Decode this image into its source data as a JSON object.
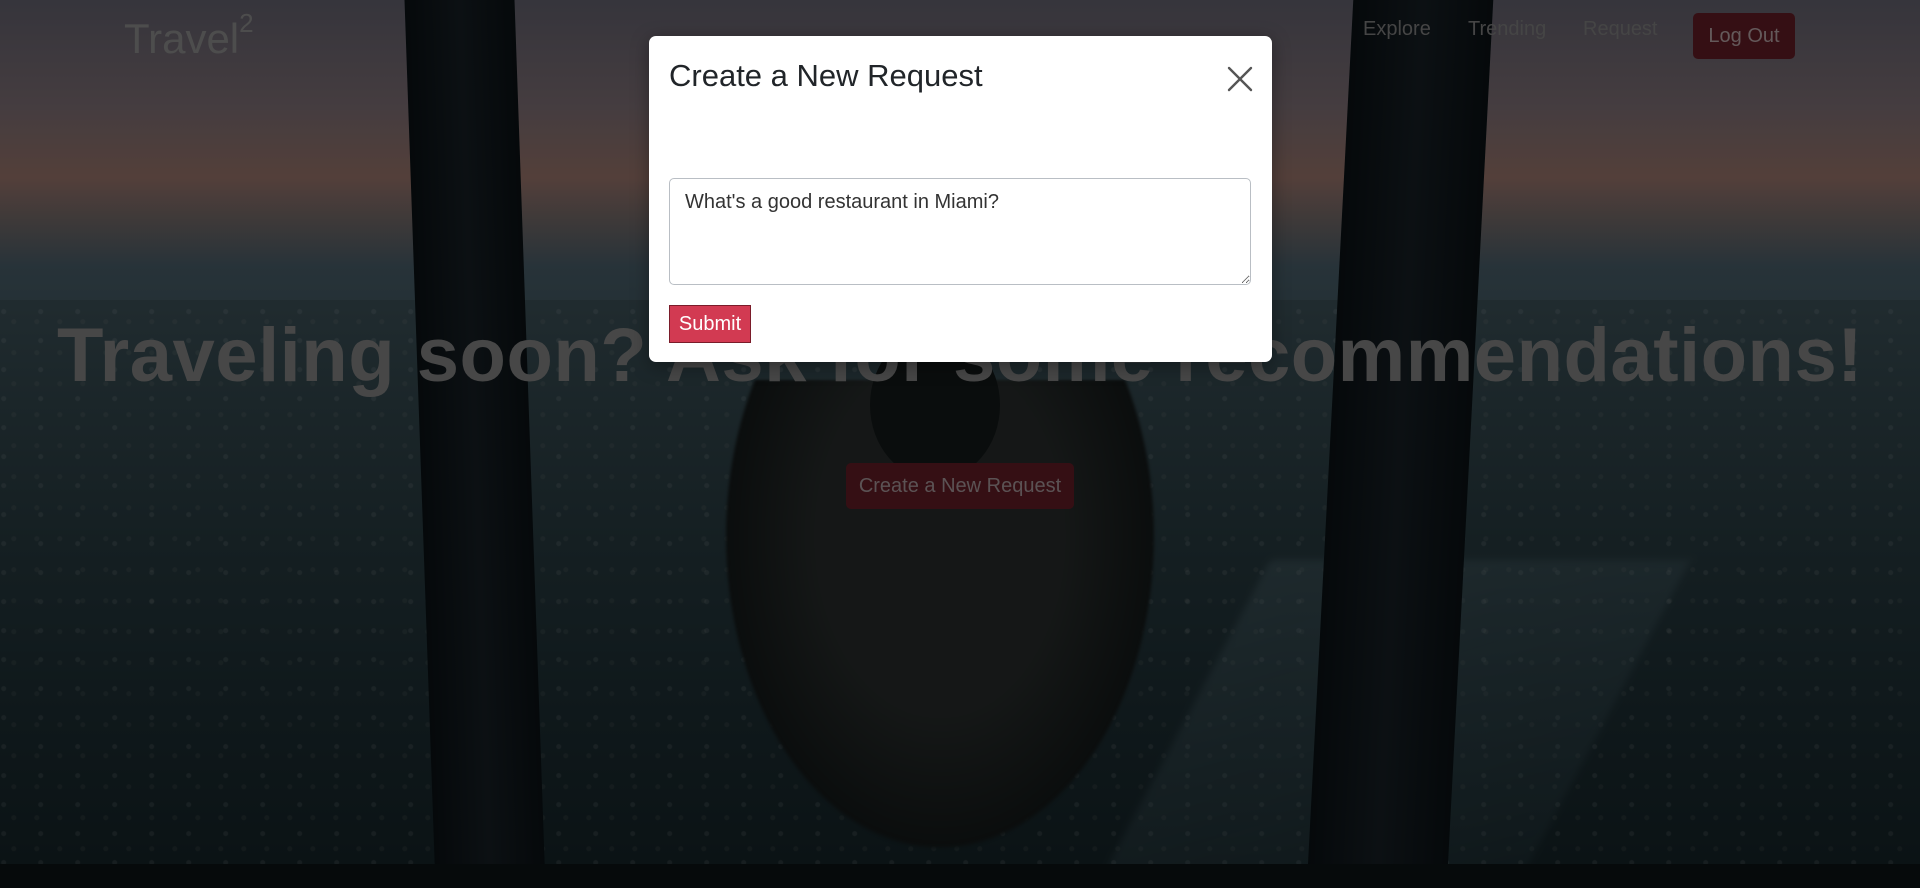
{
  "brand": {
    "name": "Travel",
    "superscript": "2"
  },
  "nav": {
    "links": [
      "Explore",
      "Trending",
      "Request"
    ],
    "logout_label": "Log Out"
  },
  "hero": {
    "title": "Traveling soon? Ask for some recommendations!",
    "cta_label": "Create a New Request"
  },
  "modal": {
    "title": "Create a New Request",
    "textarea_value": "What's a good restaurant in Miami?",
    "submit_label": "Submit"
  },
  "colors": {
    "accent": "#d23a52",
    "accent_dim": "#6b1f28"
  },
  "icons": {
    "close": "close-icon"
  }
}
